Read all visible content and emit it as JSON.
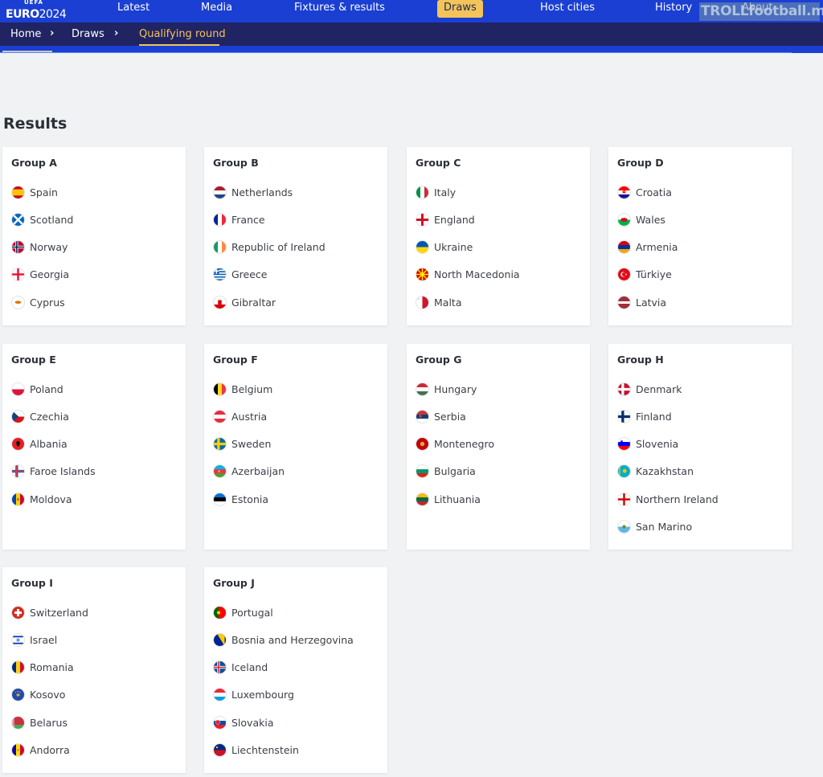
{
  "header": {
    "logo_top": "UEFA",
    "logo_main": "EURO",
    "logo_year": "2024",
    "nav": [
      {
        "label": "Latest",
        "active": false
      },
      {
        "label": "Media",
        "active": false
      },
      {
        "label": "Fixtures & results",
        "active": false
      },
      {
        "label": "Draws",
        "active": true
      },
      {
        "label": "Host cities",
        "active": false
      },
      {
        "label": "History",
        "active": false
      },
      {
        "label": "About",
        "active": false
      }
    ],
    "watermark": "TROLLfootball.me",
    "colors": {
      "nav_bg": "#1a3fd2",
      "breadcrumb_bg": "#202463",
      "accent": "#f4c35a"
    }
  },
  "breadcrumb": [
    {
      "label": "Home"
    },
    {
      "label": "Draws"
    },
    {
      "label": "Qualifying round"
    }
  ],
  "results": {
    "title": "Results",
    "groups": [
      {
        "name": "Group A",
        "teams": [
          {
            "name": "Spain",
            "flag": "spain-flag-icon"
          },
          {
            "name": "Scotland",
            "flag": "scotland-flag-icon"
          },
          {
            "name": "Norway",
            "flag": "norway-flag-icon"
          },
          {
            "name": "Georgia",
            "flag": "georgia-flag-icon"
          },
          {
            "name": "Cyprus",
            "flag": "cyprus-flag-icon"
          }
        ]
      },
      {
        "name": "Group B",
        "teams": [
          {
            "name": "Netherlands",
            "flag": "netherlands-flag-icon"
          },
          {
            "name": "France",
            "flag": "france-flag-icon"
          },
          {
            "name": "Republic of Ireland",
            "flag": "ireland-flag-icon"
          },
          {
            "name": "Greece",
            "flag": "greece-flag-icon"
          },
          {
            "name": "Gibraltar",
            "flag": "gibraltar-flag-icon"
          }
        ]
      },
      {
        "name": "Group C",
        "teams": [
          {
            "name": "Italy",
            "flag": "italy-flag-icon"
          },
          {
            "name": "England",
            "flag": "england-flag-icon"
          },
          {
            "name": "Ukraine",
            "flag": "ukraine-flag-icon"
          },
          {
            "name": "North Macedonia",
            "flag": "north-macedonia-flag-icon"
          },
          {
            "name": "Malta",
            "flag": "malta-flag-icon"
          }
        ]
      },
      {
        "name": "Group D",
        "teams": [
          {
            "name": "Croatia",
            "flag": "croatia-flag-icon"
          },
          {
            "name": "Wales",
            "flag": "wales-flag-icon"
          },
          {
            "name": "Armenia",
            "flag": "armenia-flag-icon"
          },
          {
            "name": "Türkiye",
            "flag": "turkiye-flag-icon"
          },
          {
            "name": "Latvia",
            "flag": "latvia-flag-icon"
          }
        ]
      },
      {
        "name": "Group E",
        "teams": [
          {
            "name": "Poland",
            "flag": "poland-flag-icon"
          },
          {
            "name": "Czechia",
            "flag": "czechia-flag-icon"
          },
          {
            "name": "Albania",
            "flag": "albania-flag-icon"
          },
          {
            "name": "Faroe Islands",
            "flag": "faroe-islands-flag-icon"
          },
          {
            "name": "Moldova",
            "flag": "moldova-flag-icon"
          }
        ]
      },
      {
        "name": "Group F",
        "teams": [
          {
            "name": "Belgium",
            "flag": "belgium-flag-icon"
          },
          {
            "name": "Austria",
            "flag": "austria-flag-icon"
          },
          {
            "name": "Sweden",
            "flag": "sweden-flag-icon"
          },
          {
            "name": "Azerbaijan",
            "flag": "azerbaijan-flag-icon"
          },
          {
            "name": "Estonia",
            "flag": "estonia-flag-icon"
          }
        ]
      },
      {
        "name": "Group G",
        "teams": [
          {
            "name": "Hungary",
            "flag": "hungary-flag-icon"
          },
          {
            "name": "Serbia",
            "flag": "serbia-flag-icon"
          },
          {
            "name": "Montenegro",
            "flag": "montenegro-flag-icon"
          },
          {
            "name": "Bulgaria",
            "flag": "bulgaria-flag-icon"
          },
          {
            "name": "Lithuania",
            "flag": "lithuania-flag-icon"
          }
        ]
      },
      {
        "name": "Group H",
        "teams": [
          {
            "name": "Denmark",
            "flag": "denmark-flag-icon"
          },
          {
            "name": "Finland",
            "flag": "finland-flag-icon"
          },
          {
            "name": "Slovenia",
            "flag": "slovenia-flag-icon"
          },
          {
            "name": "Kazakhstan",
            "flag": "kazakhstan-flag-icon"
          },
          {
            "name": "Northern Ireland",
            "flag": "northern-ireland-flag-icon"
          },
          {
            "name": "San Marino",
            "flag": "san-marino-flag-icon"
          }
        ]
      },
      {
        "name": "Group I",
        "teams": [
          {
            "name": "Switzerland",
            "flag": "switzerland-flag-icon"
          },
          {
            "name": "Israel",
            "flag": "israel-flag-icon"
          },
          {
            "name": "Romania",
            "flag": "romania-flag-icon"
          },
          {
            "name": "Kosovo",
            "flag": "kosovo-flag-icon"
          },
          {
            "name": "Belarus",
            "flag": "belarus-flag-icon"
          },
          {
            "name": "Andorra",
            "flag": "andorra-flag-icon"
          }
        ]
      },
      {
        "name": "Group J",
        "teams": [
          {
            "name": "Portugal",
            "flag": "portugal-flag-icon"
          },
          {
            "name": "Bosnia and Herzegovina",
            "flag": "bosnia-flag-icon"
          },
          {
            "name": "Iceland",
            "flag": "iceland-flag-icon"
          },
          {
            "name": "Luxembourg",
            "flag": "luxembourg-flag-icon"
          },
          {
            "name": "Slovakia",
            "flag": "slovakia-flag-icon"
          },
          {
            "name": "Liechtenstein",
            "flag": "liechtenstein-flag-icon"
          }
        ]
      }
    ]
  }
}
